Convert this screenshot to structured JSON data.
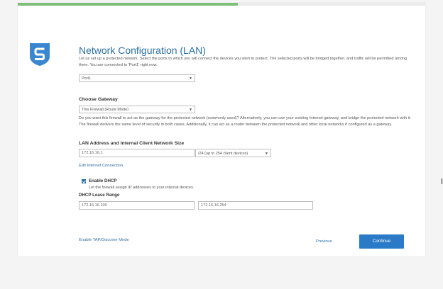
{
  "progress": {
    "fraction": 0.54
  },
  "header": {
    "title": "Network Configuration (LAN)"
  },
  "intro_text": "Let us set up a protected network. Select the ports to which you will connect the devices you wish to protect. The selected ports will be bridged together, and traffic will be permitted among them. You are connected to 'Port1' right now.",
  "ports_select": {
    "value": "Port1"
  },
  "gateway": {
    "label": "Choose Gateway",
    "value": "This Firewall (Route Mode)",
    "description": "Do you want this firewall to act as the gateway for the protected network (commonly used)? Alternatively, you can use your existing Internet gateway, and bridge the protected network with it. The firewall delivers the same level of security in both cases. Additionally, it can act as a router between the protected network and other local networks if configured as a gateway."
  },
  "lan": {
    "label": "LAN Address and Internal Client Network Size",
    "address_value": "172.16.16.1",
    "subnet_value": "/24 (up to 254 client devices)"
  },
  "edit_internet_link": "Edit Internet Connection",
  "dhcp": {
    "enabled": true,
    "label": "Enable DHCP",
    "description": "Let the firewall assign IP addresses to your internal devices.",
    "lease_label": "DHCP Lease Range",
    "range_start": "172.16.16.100",
    "range_separator": "-",
    "range_end": "172.16.16.254"
  },
  "footer": {
    "tap_link": "Enable TAP/Discover Mode",
    "previous_label": "Previous",
    "continue_label": "Continue"
  },
  "icons": {
    "logo": "sophos-shield-logo-icon",
    "dropdown": "chevron-down-icon",
    "checkbox": "checkmark-icon"
  },
  "colors": {
    "accent": "#2b7ac7",
    "title": "#2b6ea5",
    "progress": "#7dbe7a",
    "logo": "#3a86d1"
  }
}
